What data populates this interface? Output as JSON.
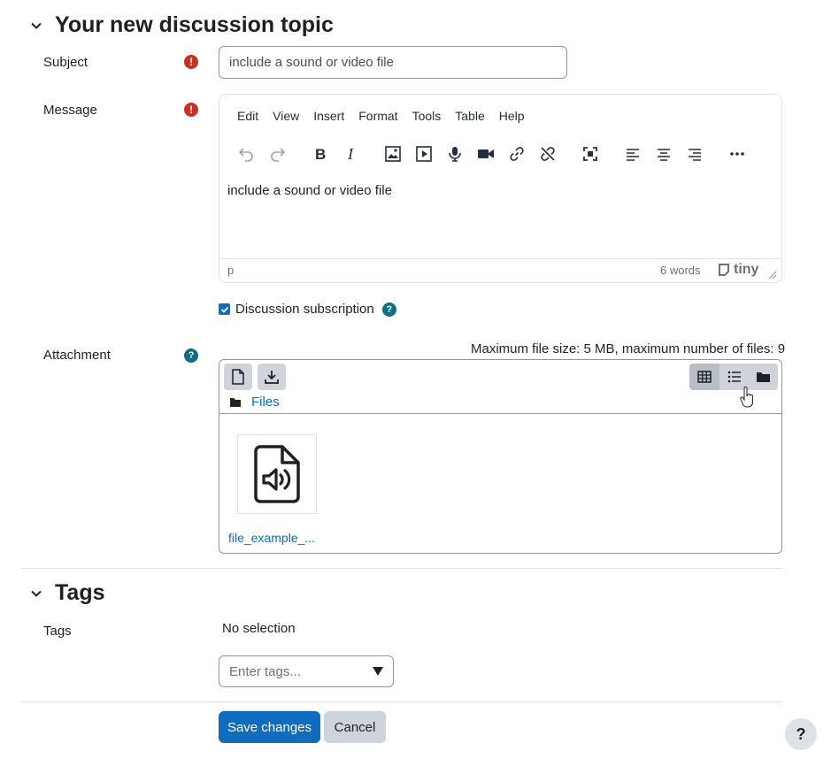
{
  "topic_section": {
    "title": "Your new discussion topic"
  },
  "subject": {
    "label": "Subject",
    "value": "include a sound or video file"
  },
  "message": {
    "label": "Message",
    "menu": [
      "Edit",
      "View",
      "Insert",
      "Format",
      "Tools",
      "Table",
      "Help"
    ],
    "content": "include a sound or video file",
    "status_path": "p",
    "word_count": "6 words",
    "brand": "tiny"
  },
  "subscription": {
    "label": "Discussion subscription",
    "checked": true
  },
  "attachment": {
    "label": "Attachment",
    "limits": "Maximum file size: 5 MB, maximum number of files: 9",
    "breadcrumb": "Files",
    "file_name": "file_example_..."
  },
  "tags_section": {
    "title": "Tags",
    "label": "Tags",
    "selection": "No selection",
    "placeholder": "Enter tags..."
  },
  "actions": {
    "save": "Save changes",
    "cancel": "Cancel"
  },
  "help_button": "?",
  "colors": {
    "primary": "#0f6cbf",
    "required": "#ca3120",
    "info": "#0f6e84",
    "secondary": "#ced4da"
  }
}
